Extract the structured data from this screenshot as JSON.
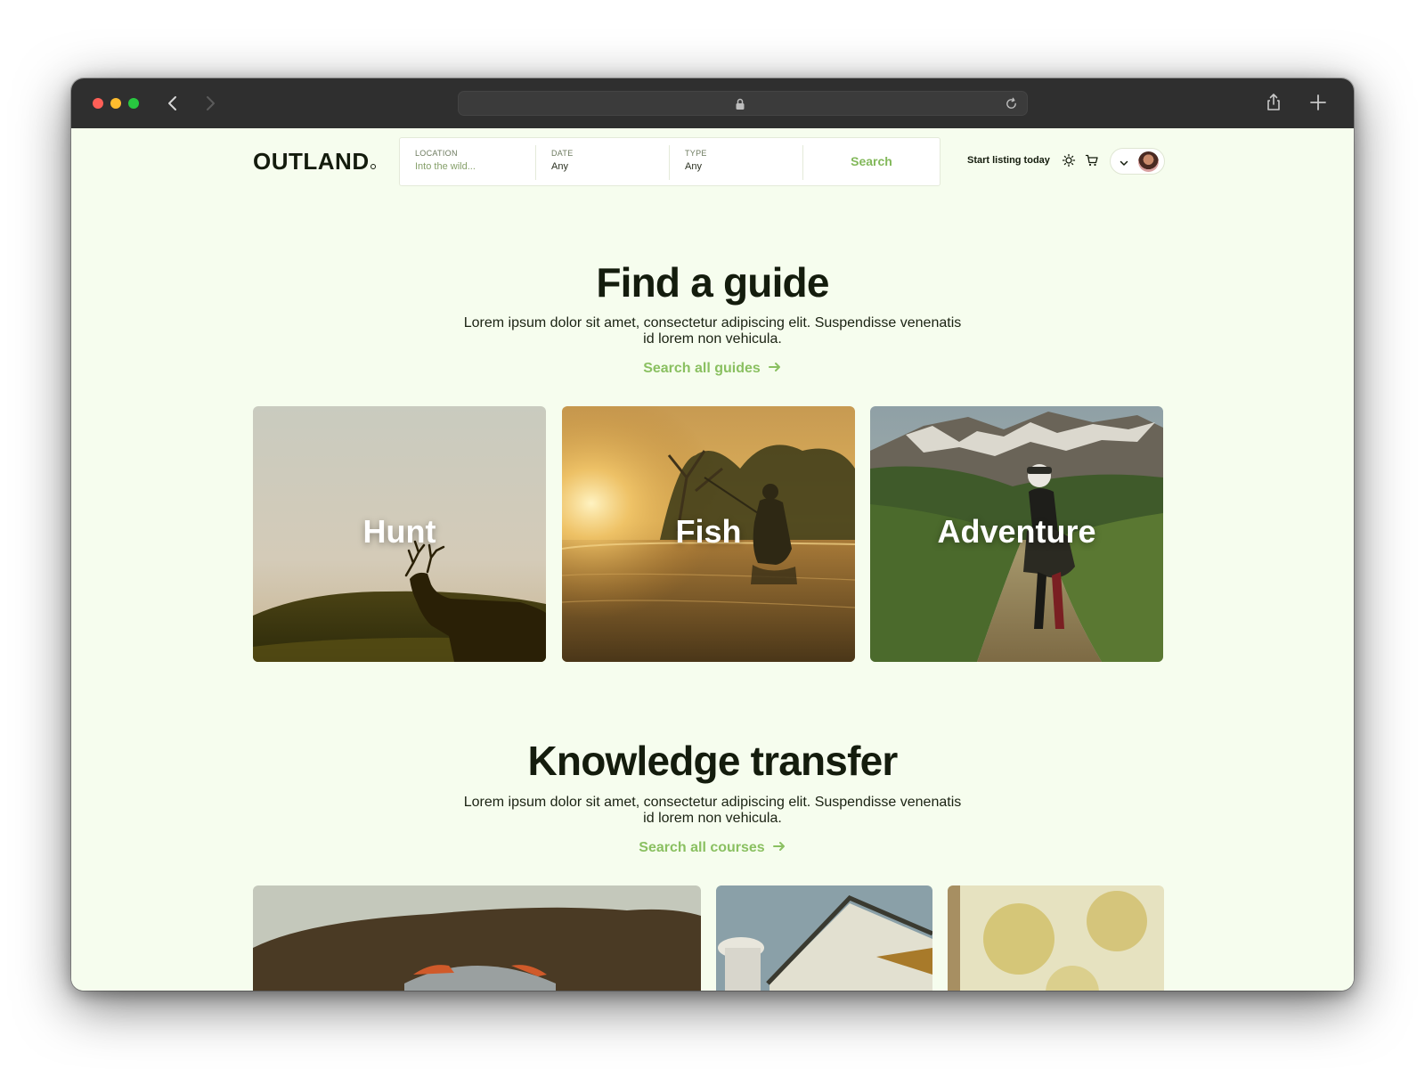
{
  "header": {
    "logo": "OUTLAND",
    "search": {
      "location_label": "LOCATION",
      "location_placeholder": "Into the wild...",
      "date_label": "DATE",
      "date_value": "Any",
      "type_label": "TYPE",
      "type_value": "Any",
      "button_label": "Search"
    },
    "start_listing": "Start listing today",
    "icons": [
      "sun-icon",
      "cart-icon",
      "chevron-down-icon",
      "avatar"
    ]
  },
  "guides": {
    "title": "Find a guide",
    "description": "Lorem ipsum dolor sit amet, consectetur adipiscing elit. Suspendisse venenatis id lorem non vehicula.",
    "link": "Search all guides",
    "cards": [
      {
        "label": "Hunt"
      },
      {
        "label": "Fish"
      },
      {
        "label": "Adventure"
      }
    ]
  },
  "knowledge": {
    "title": "Knowledge transfer",
    "description": "Lorem ipsum dolor sit amet, consectetur adipiscing elit. Suspendisse venenatis id lorem non vehicula.",
    "link": "Search all courses"
  },
  "colors": {
    "page_bg": "#f6fdee",
    "accent": "#8ac061",
    "text": "#141c0d",
    "chrome": "#2f2f2f"
  }
}
